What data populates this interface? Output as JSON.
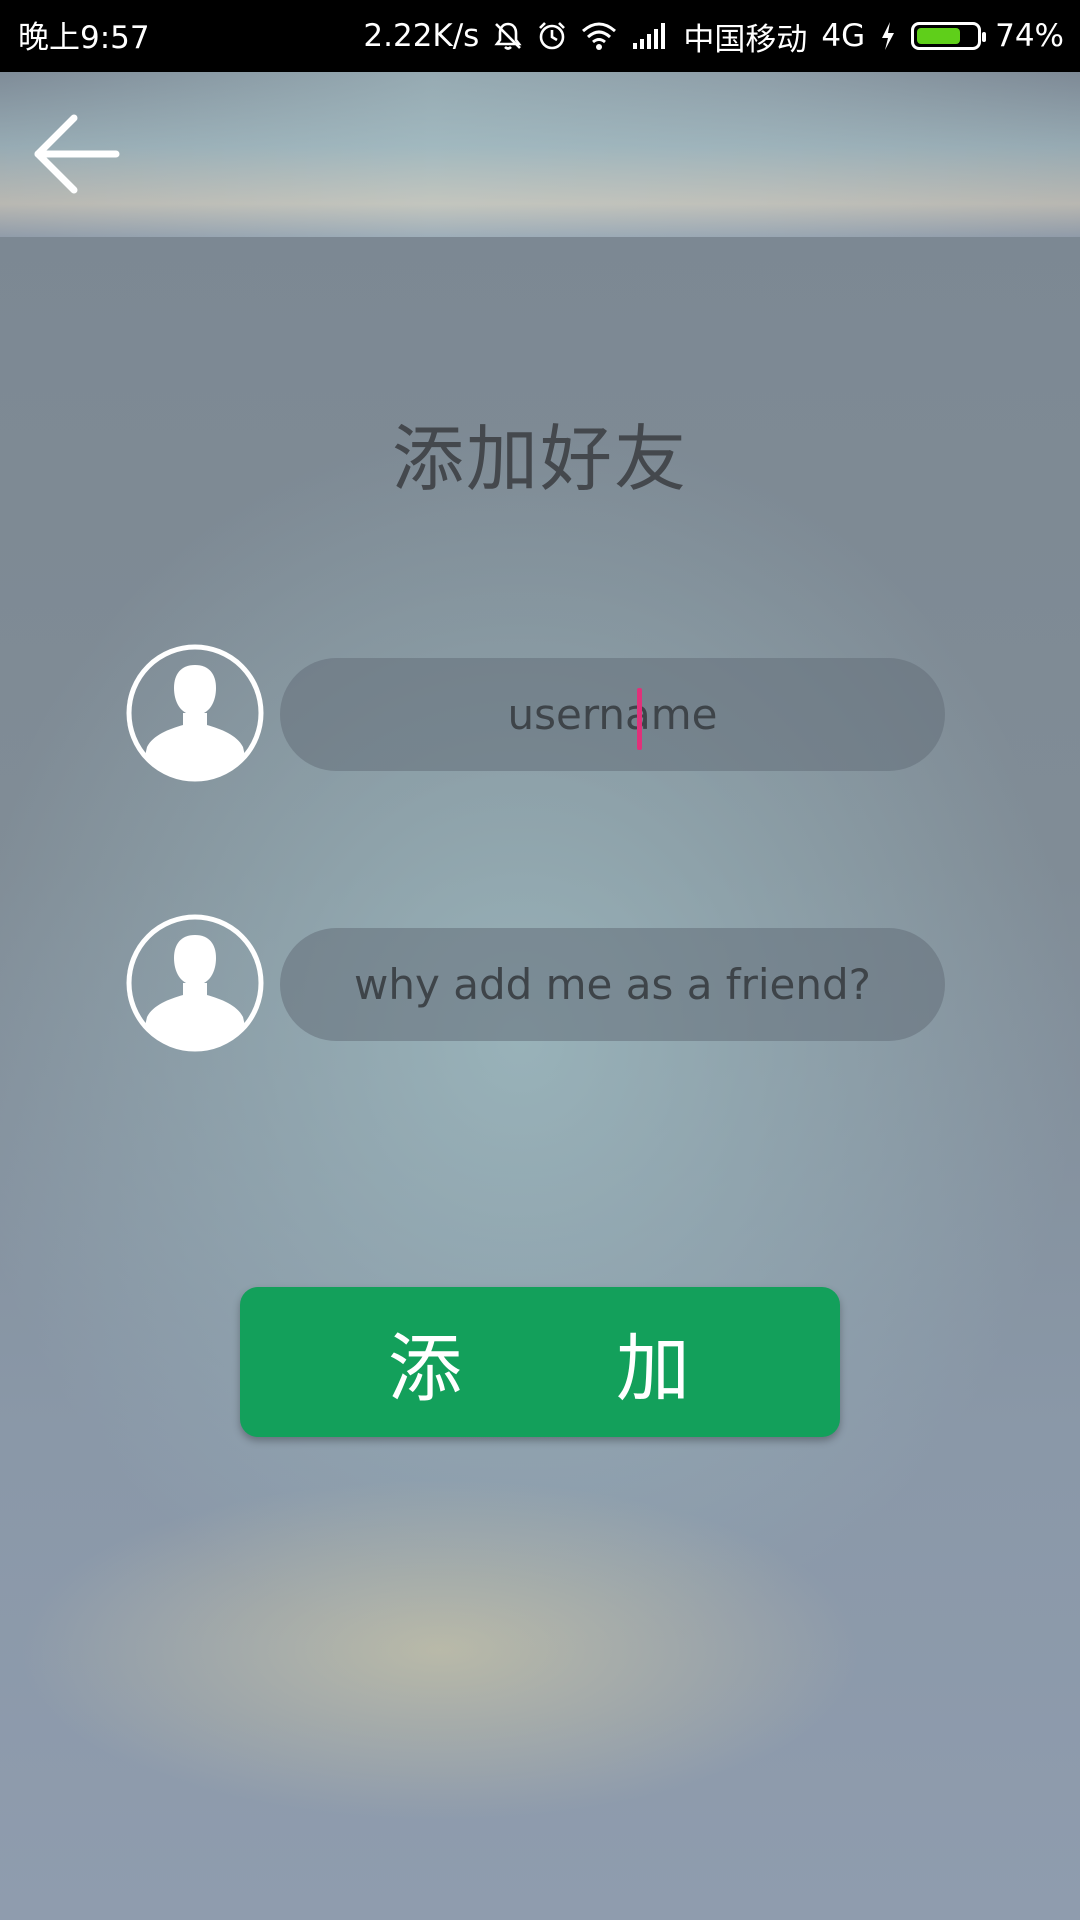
{
  "status_bar": {
    "time": "晚上9:57",
    "net_speed": "2.22K/s",
    "carrier": "中国移动",
    "network_type": "4G",
    "battery_percent": "74%",
    "battery_level": 0.74,
    "battery_color": "#5fcf1a",
    "icons": [
      "mute-icon",
      "alarm-icon",
      "wifi-icon",
      "signal-icon",
      "charging-icon",
      "battery-icon"
    ]
  },
  "toolbar": {
    "back_icon": "arrow-left-icon"
  },
  "page": {
    "title": "添加好友"
  },
  "form": {
    "username": {
      "placeholder": "username",
      "value": "",
      "icon": "user-avatar-icon"
    },
    "reason": {
      "placeholder": "why add me as a friend?",
      "value": "",
      "icon": "user-avatar-icon"
    }
  },
  "actions": {
    "add_label": "添　　加",
    "add_color": "#13a05b"
  }
}
